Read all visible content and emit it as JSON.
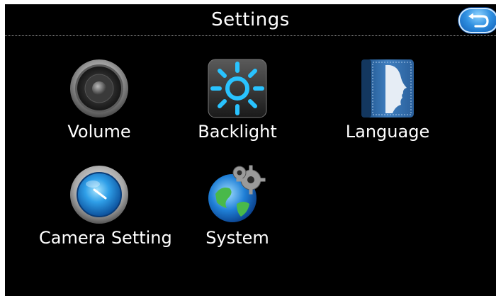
{
  "header": {
    "title": "Settings",
    "back_icon": "back-arrow-icon"
  },
  "colors": {
    "screen_background": "#000000",
    "text": "#ffffff",
    "back_button_blue": "#2f8fe0",
    "divider": "#9a9a9a"
  },
  "menu": {
    "items": [
      {
        "label": "Volume",
        "icon": "speaker-icon"
      },
      {
        "label": "Backlight",
        "icon": "sun-icon"
      },
      {
        "label": "Language",
        "icon": "book-profile-icon"
      },
      {
        "label": "Camera Setting",
        "icon": "camera-lens-icon"
      },
      {
        "label": "System",
        "icon": "globe-gears-icon"
      }
    ]
  }
}
